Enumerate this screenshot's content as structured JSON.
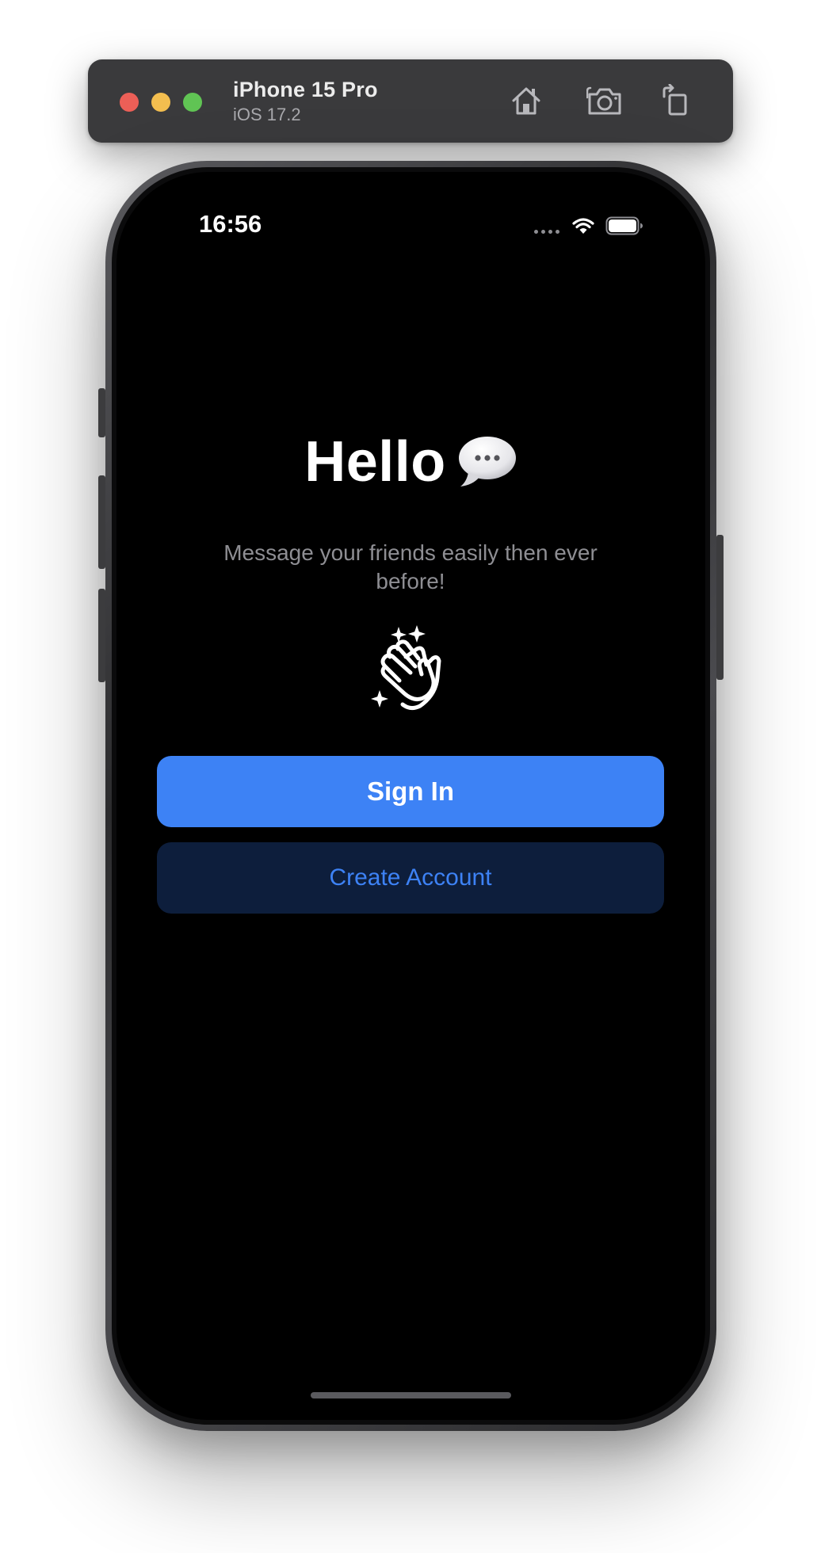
{
  "simulator": {
    "device_name": "iPhone 15 Pro",
    "os_version": "iOS 17.2",
    "traffic_lights": {
      "close": "#ec5f57",
      "minimize": "#f3be4f",
      "zoom": "#60c454"
    },
    "toolbar_icons": [
      "home-icon",
      "camera-icon",
      "rotate-icon"
    ]
  },
  "status_bar": {
    "time": "16:56",
    "icons": [
      "cellular-dots-icon",
      "wifi-icon",
      "battery-icon"
    ]
  },
  "welcome": {
    "title": "Hello",
    "title_icon": "speech-bubble-icon",
    "subtitle": "Message your friends easily then ever before!",
    "illustration": "clapping-hands-sparkles-icon"
  },
  "actions": {
    "sign_in_label": "Sign In",
    "create_account_label": "Create Account"
  },
  "colors": {
    "accent": "#3d82f5",
    "secondary_button_bg": "#0d1e3c",
    "screen_bg": "#000000",
    "subtitle_text": "#8e8e93"
  }
}
